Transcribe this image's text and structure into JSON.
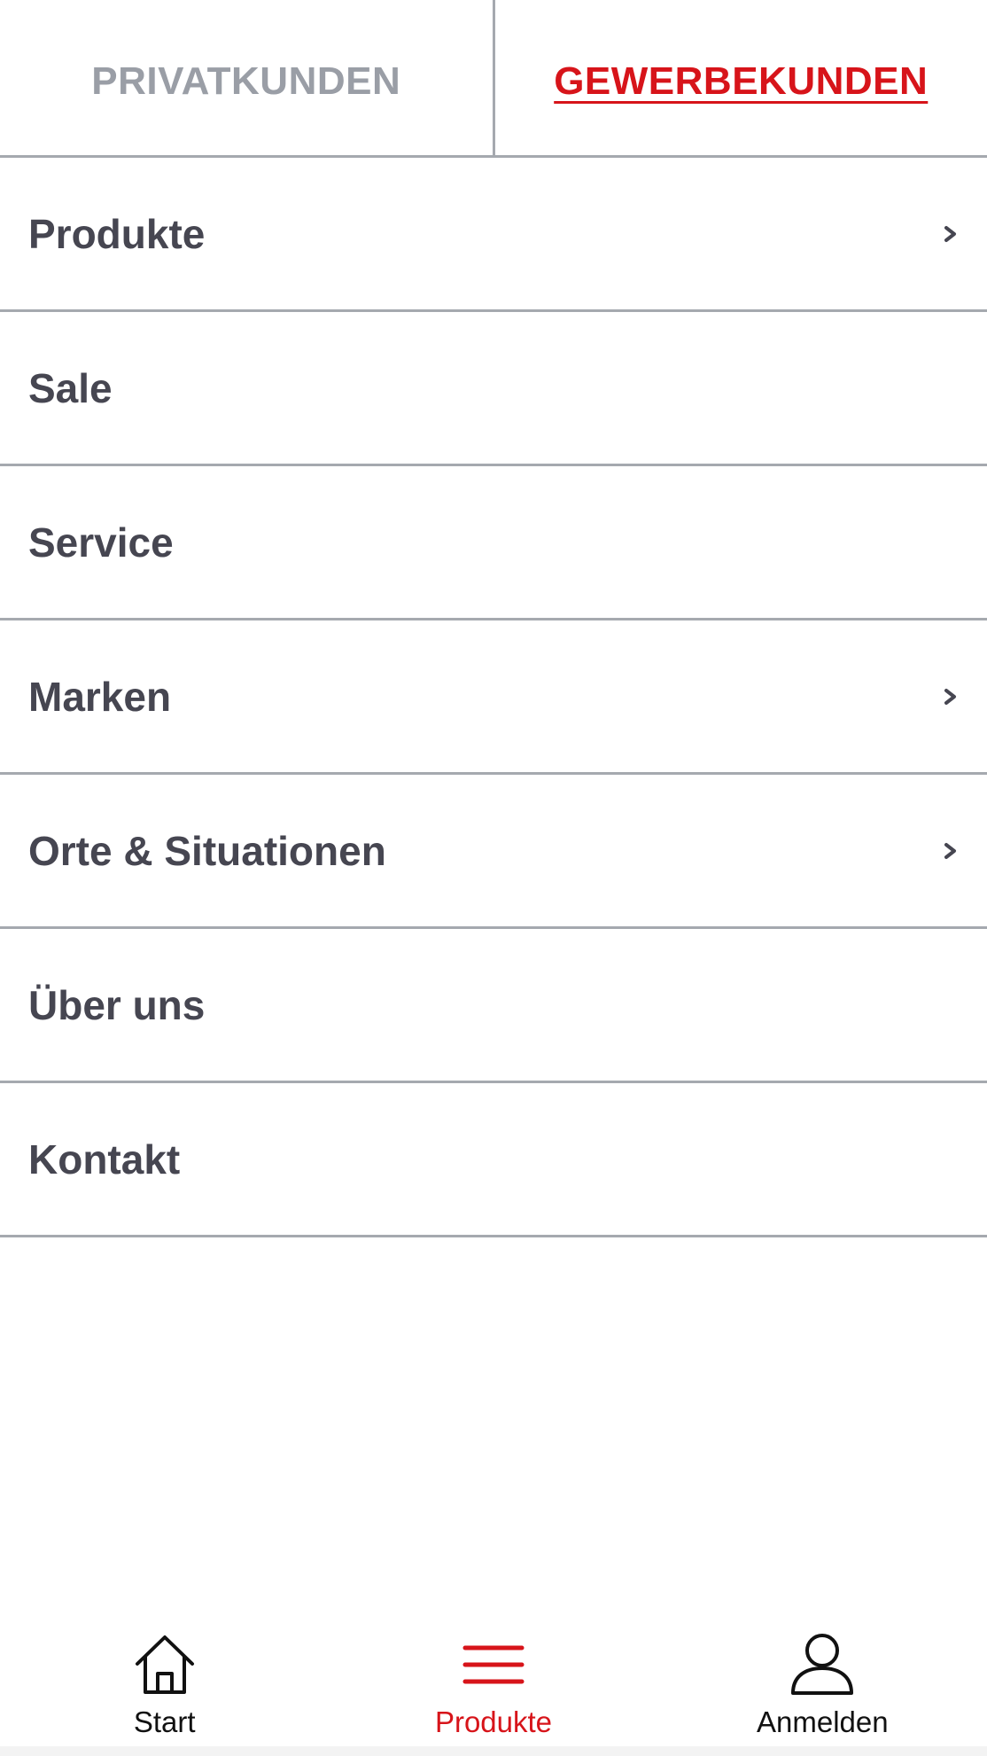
{
  "tabs": {
    "private_label": "PRIVATKUNDEN",
    "business_label": "GEWERBEKUNDEN",
    "active": "business"
  },
  "menu": {
    "items": [
      {
        "label": "Produkte",
        "has_submenu": true
      },
      {
        "label": "Sale",
        "has_submenu": false
      },
      {
        "label": "Service",
        "has_submenu": false
      },
      {
        "label": "Marken",
        "has_submenu": true
      },
      {
        "label": "Orte & Situationen",
        "has_submenu": true
      },
      {
        "label": "Über uns",
        "has_submenu": false
      },
      {
        "label": "Kontakt",
        "has_submenu": false
      }
    ],
    "chevron_icon": "chevron-right-icon"
  },
  "bottom_nav": {
    "start_label": "Start",
    "start_icon": "home-icon",
    "products_label": "Produkte",
    "products_icon": "menu-icon",
    "login_label": "Anmelden",
    "login_icon": "user-icon",
    "active": "products"
  },
  "colors": {
    "accent": "#d7141a",
    "text": "#464651",
    "inactive_tab": "#9a9ea6",
    "divider": "#a5a9af"
  }
}
